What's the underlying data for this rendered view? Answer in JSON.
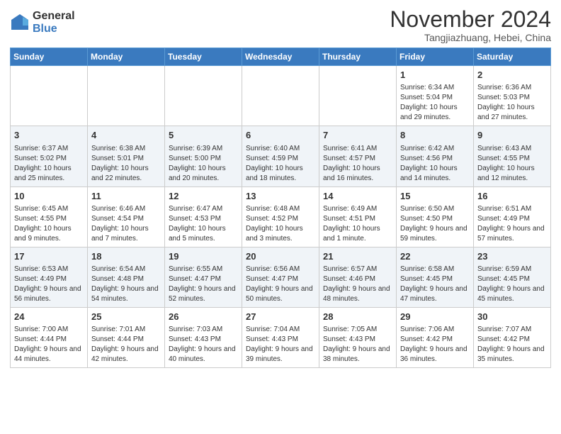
{
  "logo": {
    "general": "General",
    "blue": "Blue"
  },
  "title": "November 2024",
  "location": "Tangjiazhuang, Hebei, China",
  "days_of_week": [
    "Sunday",
    "Monday",
    "Tuesday",
    "Wednesday",
    "Thursday",
    "Friday",
    "Saturday"
  ],
  "weeks": [
    [
      {
        "day": "",
        "info": ""
      },
      {
        "day": "",
        "info": ""
      },
      {
        "day": "",
        "info": ""
      },
      {
        "day": "",
        "info": ""
      },
      {
        "day": "",
        "info": ""
      },
      {
        "day": "1",
        "info": "Sunrise: 6:34 AM\nSunset: 5:04 PM\nDaylight: 10 hours and 29 minutes."
      },
      {
        "day": "2",
        "info": "Sunrise: 6:36 AM\nSunset: 5:03 PM\nDaylight: 10 hours and 27 minutes."
      }
    ],
    [
      {
        "day": "3",
        "info": "Sunrise: 6:37 AM\nSunset: 5:02 PM\nDaylight: 10 hours and 25 minutes."
      },
      {
        "day": "4",
        "info": "Sunrise: 6:38 AM\nSunset: 5:01 PM\nDaylight: 10 hours and 22 minutes."
      },
      {
        "day": "5",
        "info": "Sunrise: 6:39 AM\nSunset: 5:00 PM\nDaylight: 10 hours and 20 minutes."
      },
      {
        "day": "6",
        "info": "Sunrise: 6:40 AM\nSunset: 4:59 PM\nDaylight: 10 hours and 18 minutes."
      },
      {
        "day": "7",
        "info": "Sunrise: 6:41 AM\nSunset: 4:57 PM\nDaylight: 10 hours and 16 minutes."
      },
      {
        "day": "8",
        "info": "Sunrise: 6:42 AM\nSunset: 4:56 PM\nDaylight: 10 hours and 14 minutes."
      },
      {
        "day": "9",
        "info": "Sunrise: 6:43 AM\nSunset: 4:55 PM\nDaylight: 10 hours and 12 minutes."
      }
    ],
    [
      {
        "day": "10",
        "info": "Sunrise: 6:45 AM\nSunset: 4:55 PM\nDaylight: 10 hours and 9 minutes."
      },
      {
        "day": "11",
        "info": "Sunrise: 6:46 AM\nSunset: 4:54 PM\nDaylight: 10 hours and 7 minutes."
      },
      {
        "day": "12",
        "info": "Sunrise: 6:47 AM\nSunset: 4:53 PM\nDaylight: 10 hours and 5 minutes."
      },
      {
        "day": "13",
        "info": "Sunrise: 6:48 AM\nSunset: 4:52 PM\nDaylight: 10 hours and 3 minutes."
      },
      {
        "day": "14",
        "info": "Sunrise: 6:49 AM\nSunset: 4:51 PM\nDaylight: 10 hours and 1 minute."
      },
      {
        "day": "15",
        "info": "Sunrise: 6:50 AM\nSunset: 4:50 PM\nDaylight: 9 hours and 59 minutes."
      },
      {
        "day": "16",
        "info": "Sunrise: 6:51 AM\nSunset: 4:49 PM\nDaylight: 9 hours and 57 minutes."
      }
    ],
    [
      {
        "day": "17",
        "info": "Sunrise: 6:53 AM\nSunset: 4:49 PM\nDaylight: 9 hours and 56 minutes."
      },
      {
        "day": "18",
        "info": "Sunrise: 6:54 AM\nSunset: 4:48 PM\nDaylight: 9 hours and 54 minutes."
      },
      {
        "day": "19",
        "info": "Sunrise: 6:55 AM\nSunset: 4:47 PM\nDaylight: 9 hours and 52 minutes."
      },
      {
        "day": "20",
        "info": "Sunrise: 6:56 AM\nSunset: 4:47 PM\nDaylight: 9 hours and 50 minutes."
      },
      {
        "day": "21",
        "info": "Sunrise: 6:57 AM\nSunset: 4:46 PM\nDaylight: 9 hours and 48 minutes."
      },
      {
        "day": "22",
        "info": "Sunrise: 6:58 AM\nSunset: 4:45 PM\nDaylight: 9 hours and 47 minutes."
      },
      {
        "day": "23",
        "info": "Sunrise: 6:59 AM\nSunset: 4:45 PM\nDaylight: 9 hours and 45 minutes."
      }
    ],
    [
      {
        "day": "24",
        "info": "Sunrise: 7:00 AM\nSunset: 4:44 PM\nDaylight: 9 hours and 44 minutes."
      },
      {
        "day": "25",
        "info": "Sunrise: 7:01 AM\nSunset: 4:44 PM\nDaylight: 9 hours and 42 minutes."
      },
      {
        "day": "26",
        "info": "Sunrise: 7:03 AM\nSunset: 4:43 PM\nDaylight: 9 hours and 40 minutes."
      },
      {
        "day": "27",
        "info": "Sunrise: 7:04 AM\nSunset: 4:43 PM\nDaylight: 9 hours and 39 minutes."
      },
      {
        "day": "28",
        "info": "Sunrise: 7:05 AM\nSunset: 4:43 PM\nDaylight: 9 hours and 38 minutes."
      },
      {
        "day": "29",
        "info": "Sunrise: 7:06 AM\nSunset: 4:42 PM\nDaylight: 9 hours and 36 minutes."
      },
      {
        "day": "30",
        "info": "Sunrise: 7:07 AM\nSunset: 4:42 PM\nDaylight: 9 hours and 35 minutes."
      }
    ]
  ]
}
